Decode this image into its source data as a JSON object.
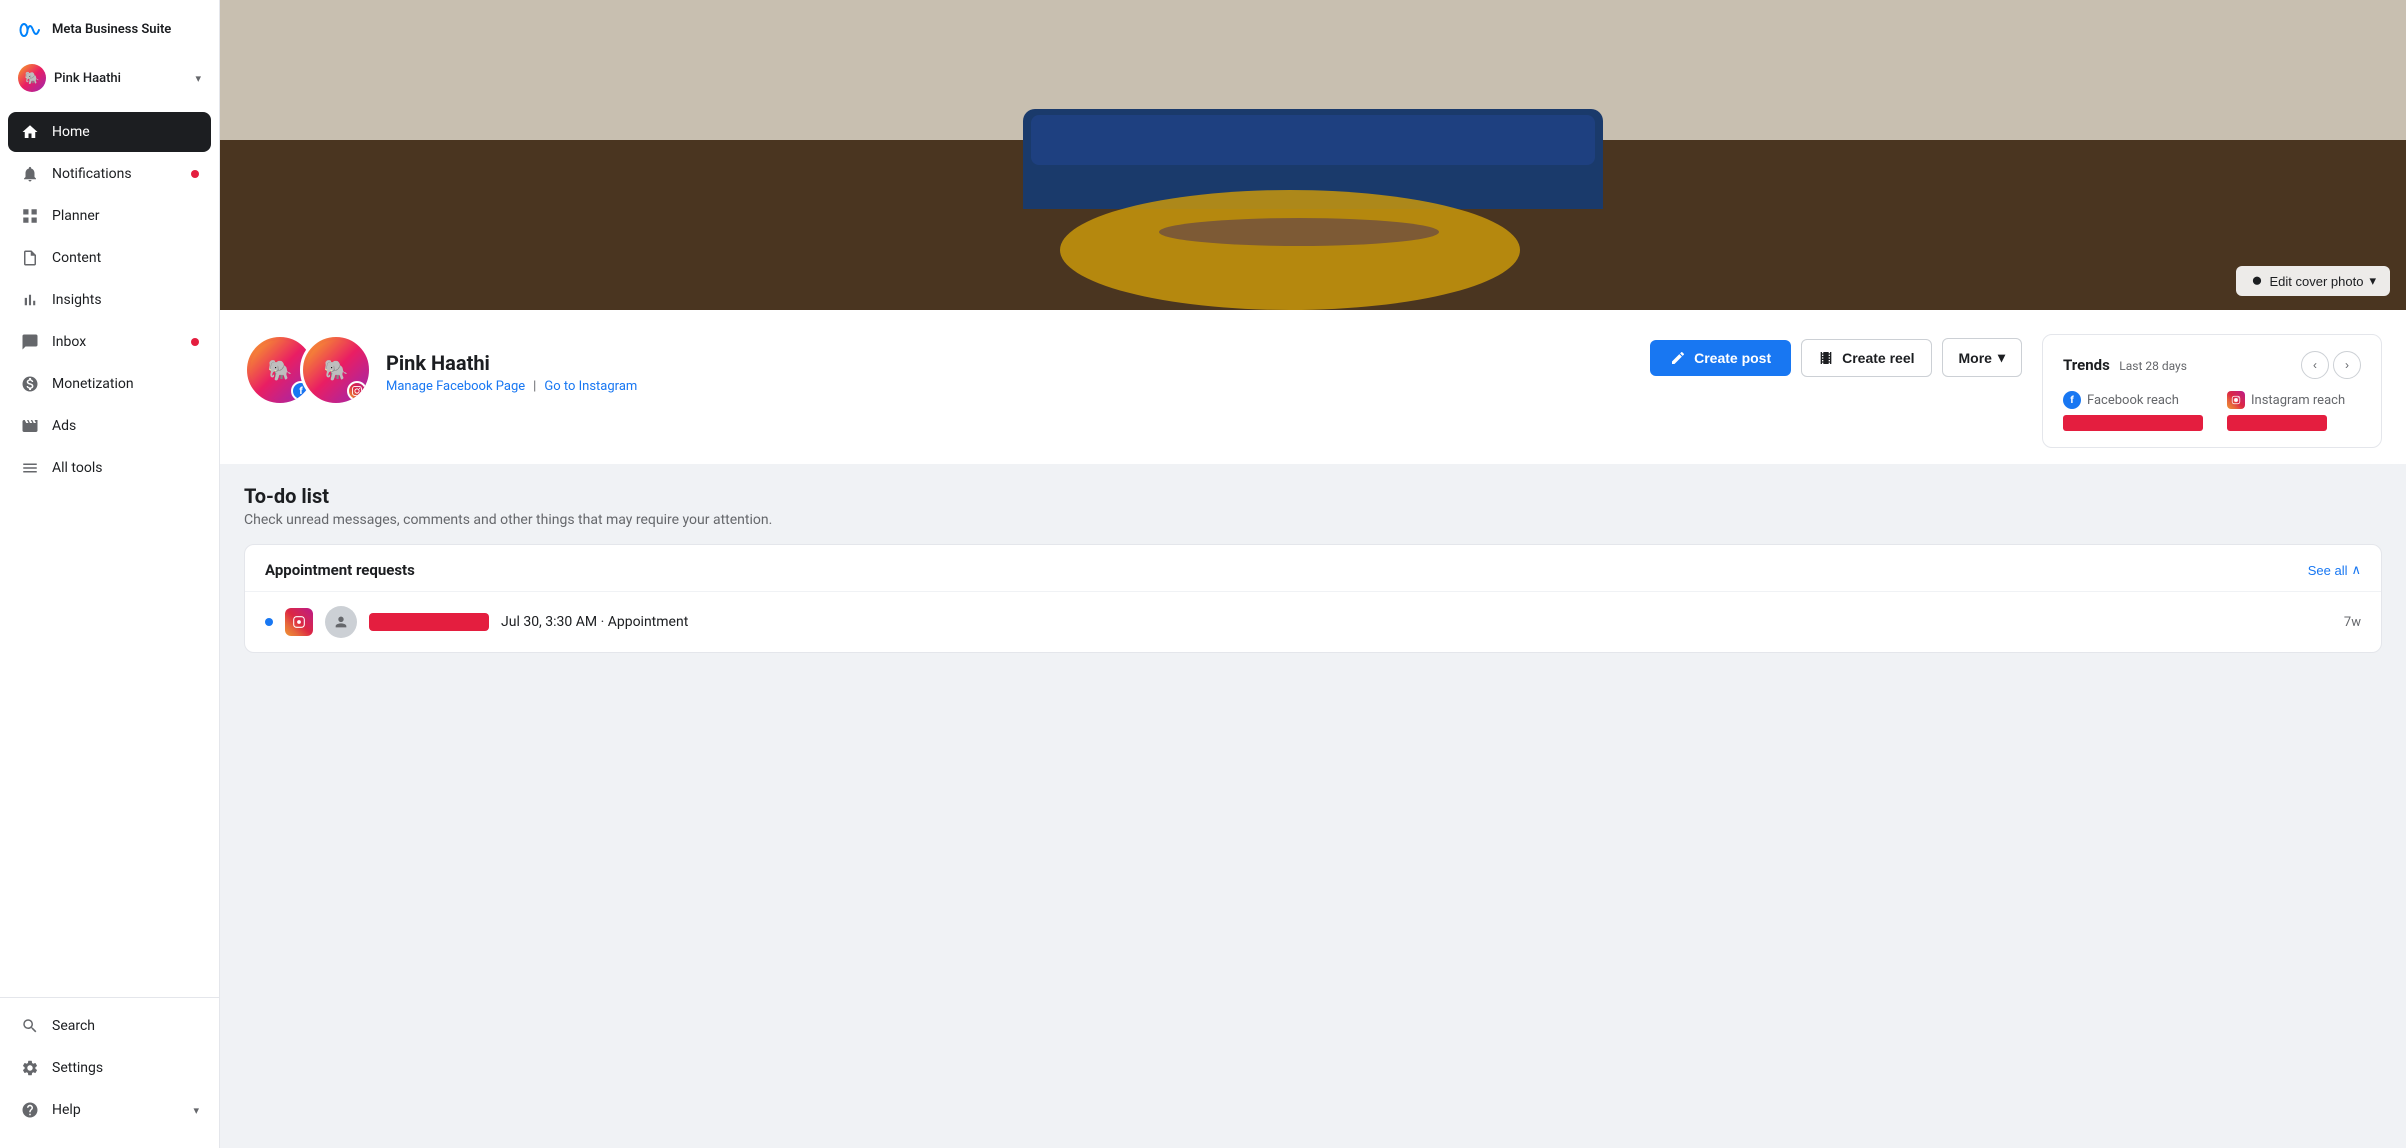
{
  "app": {
    "title": "Meta Business Suite"
  },
  "sidebar": {
    "logo_text": "Meta\nBusiness Suite",
    "account": {
      "name": "Pink Haathi",
      "chevron": "▾"
    },
    "nav_items": [
      {
        "id": "home",
        "label": "Home",
        "icon": "home",
        "active": true,
        "badge": false
      },
      {
        "id": "notifications",
        "label": "Notifications",
        "icon": "bell",
        "active": false,
        "badge": true
      },
      {
        "id": "planner",
        "label": "Planner",
        "icon": "grid",
        "active": false,
        "badge": false
      },
      {
        "id": "content",
        "label": "Content",
        "icon": "file",
        "active": false,
        "badge": false
      },
      {
        "id": "insights",
        "label": "Insights",
        "icon": "bar-chart",
        "active": false,
        "badge": false
      },
      {
        "id": "inbox",
        "label": "Inbox",
        "icon": "message",
        "active": false,
        "badge": true
      },
      {
        "id": "monetization",
        "label": "Monetization",
        "icon": "dollar",
        "active": false,
        "badge": false
      },
      {
        "id": "ads",
        "label": "Ads",
        "icon": "megaphone",
        "active": false,
        "badge": false
      },
      {
        "id": "all-tools",
        "label": "All tools",
        "icon": "menu",
        "active": false,
        "badge": false
      }
    ],
    "bottom_items": [
      {
        "id": "search",
        "label": "Search",
        "icon": "search"
      },
      {
        "id": "settings",
        "label": "Settings",
        "icon": "gear"
      },
      {
        "id": "help",
        "label": "Help",
        "icon": "question",
        "has_chevron": true
      }
    ]
  },
  "profile": {
    "name": "Pink Haathi",
    "manage_fb_label": "Manage Facebook Page",
    "go_to_ig_label": "Go to Instagram",
    "edit_cover_label": "Edit cover photo"
  },
  "actions": {
    "create_post_label": "Create post",
    "create_reel_label": "Create reel",
    "more_label": "More"
  },
  "trends": {
    "title": "Trends",
    "period": "Last 28 days",
    "facebook_reach_label": "Facebook reach",
    "instagram_reach_label": "Instagram reach"
  },
  "todo": {
    "title": "To-do list",
    "subtitle": "Check unread messages, comments and other things that may require your attention."
  },
  "appointments": {
    "section_title": "Appointment requests",
    "see_all_label": "See all",
    "row": {
      "time": "Jul 30, 3:30 AM · Appointment",
      "age": "7w"
    }
  }
}
